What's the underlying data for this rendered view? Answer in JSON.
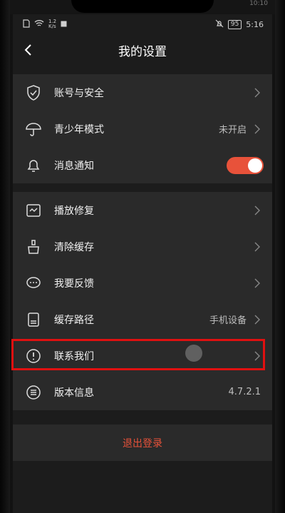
{
  "outer_status": {
    "time": "10:10"
  },
  "statusbar": {
    "speed": "1.2\nK/s",
    "battery": "95",
    "time": "5:16"
  },
  "header": {
    "title": "我的设置"
  },
  "section1": [
    {
      "label": "账号与安全",
      "icon": "shield-icon"
    },
    {
      "label": "青少年模式",
      "icon": "umbrella-icon",
      "value": "未开启"
    },
    {
      "label": "消息通知",
      "icon": "bell-icon",
      "toggle_on": true
    }
  ],
  "section2": [
    {
      "label": "播放修复",
      "icon": "wrench-icon"
    },
    {
      "label": "清除缓存",
      "icon": "broom-icon"
    },
    {
      "label": "我要反馈",
      "icon": "chat-icon"
    },
    {
      "label": "缓存路径",
      "icon": "storage-icon",
      "value": "手机设备"
    },
    {
      "label": "联系我们",
      "icon": "info-icon"
    },
    {
      "label": "版本信息",
      "icon": "list-icon",
      "value": "4.7.2.1"
    }
  ],
  "logout": {
    "label": "退出登录"
  },
  "colors": {
    "accent": "#e8523a",
    "highlight": "#e01010"
  }
}
